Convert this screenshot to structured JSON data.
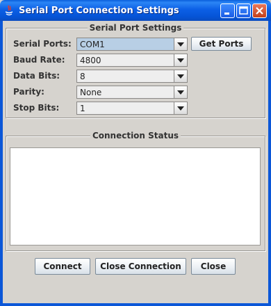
{
  "window": {
    "title": "Serial Port Connection Settings",
    "icons": [
      "java-app-icon",
      "minimize-icon",
      "maximize-icon",
      "close-icon"
    ]
  },
  "settings": {
    "group_title": "Serial Port Settings",
    "serial_ports": {
      "label": "Serial Ports:",
      "value": "COM1"
    },
    "get_ports_label": "Get Ports",
    "baud_rate": {
      "label": "Baud Rate:",
      "value": "4800"
    },
    "data_bits": {
      "label": "Data Bits:",
      "value": "8"
    },
    "parity": {
      "label": "Parity:",
      "value": "None"
    },
    "stop_bits": {
      "label": "Stop Bits:",
      "value": "1"
    }
  },
  "status": {
    "group_title": "Connection Status",
    "text": ""
  },
  "actions": {
    "connect_label": "Connect",
    "close_connection_label": "Close Connection",
    "close_label": "Close"
  },
  "colors": {
    "titlebar": "#0554d6",
    "selected_combo": "#b8cfe5",
    "window_bg": "#d6d3ce"
  }
}
